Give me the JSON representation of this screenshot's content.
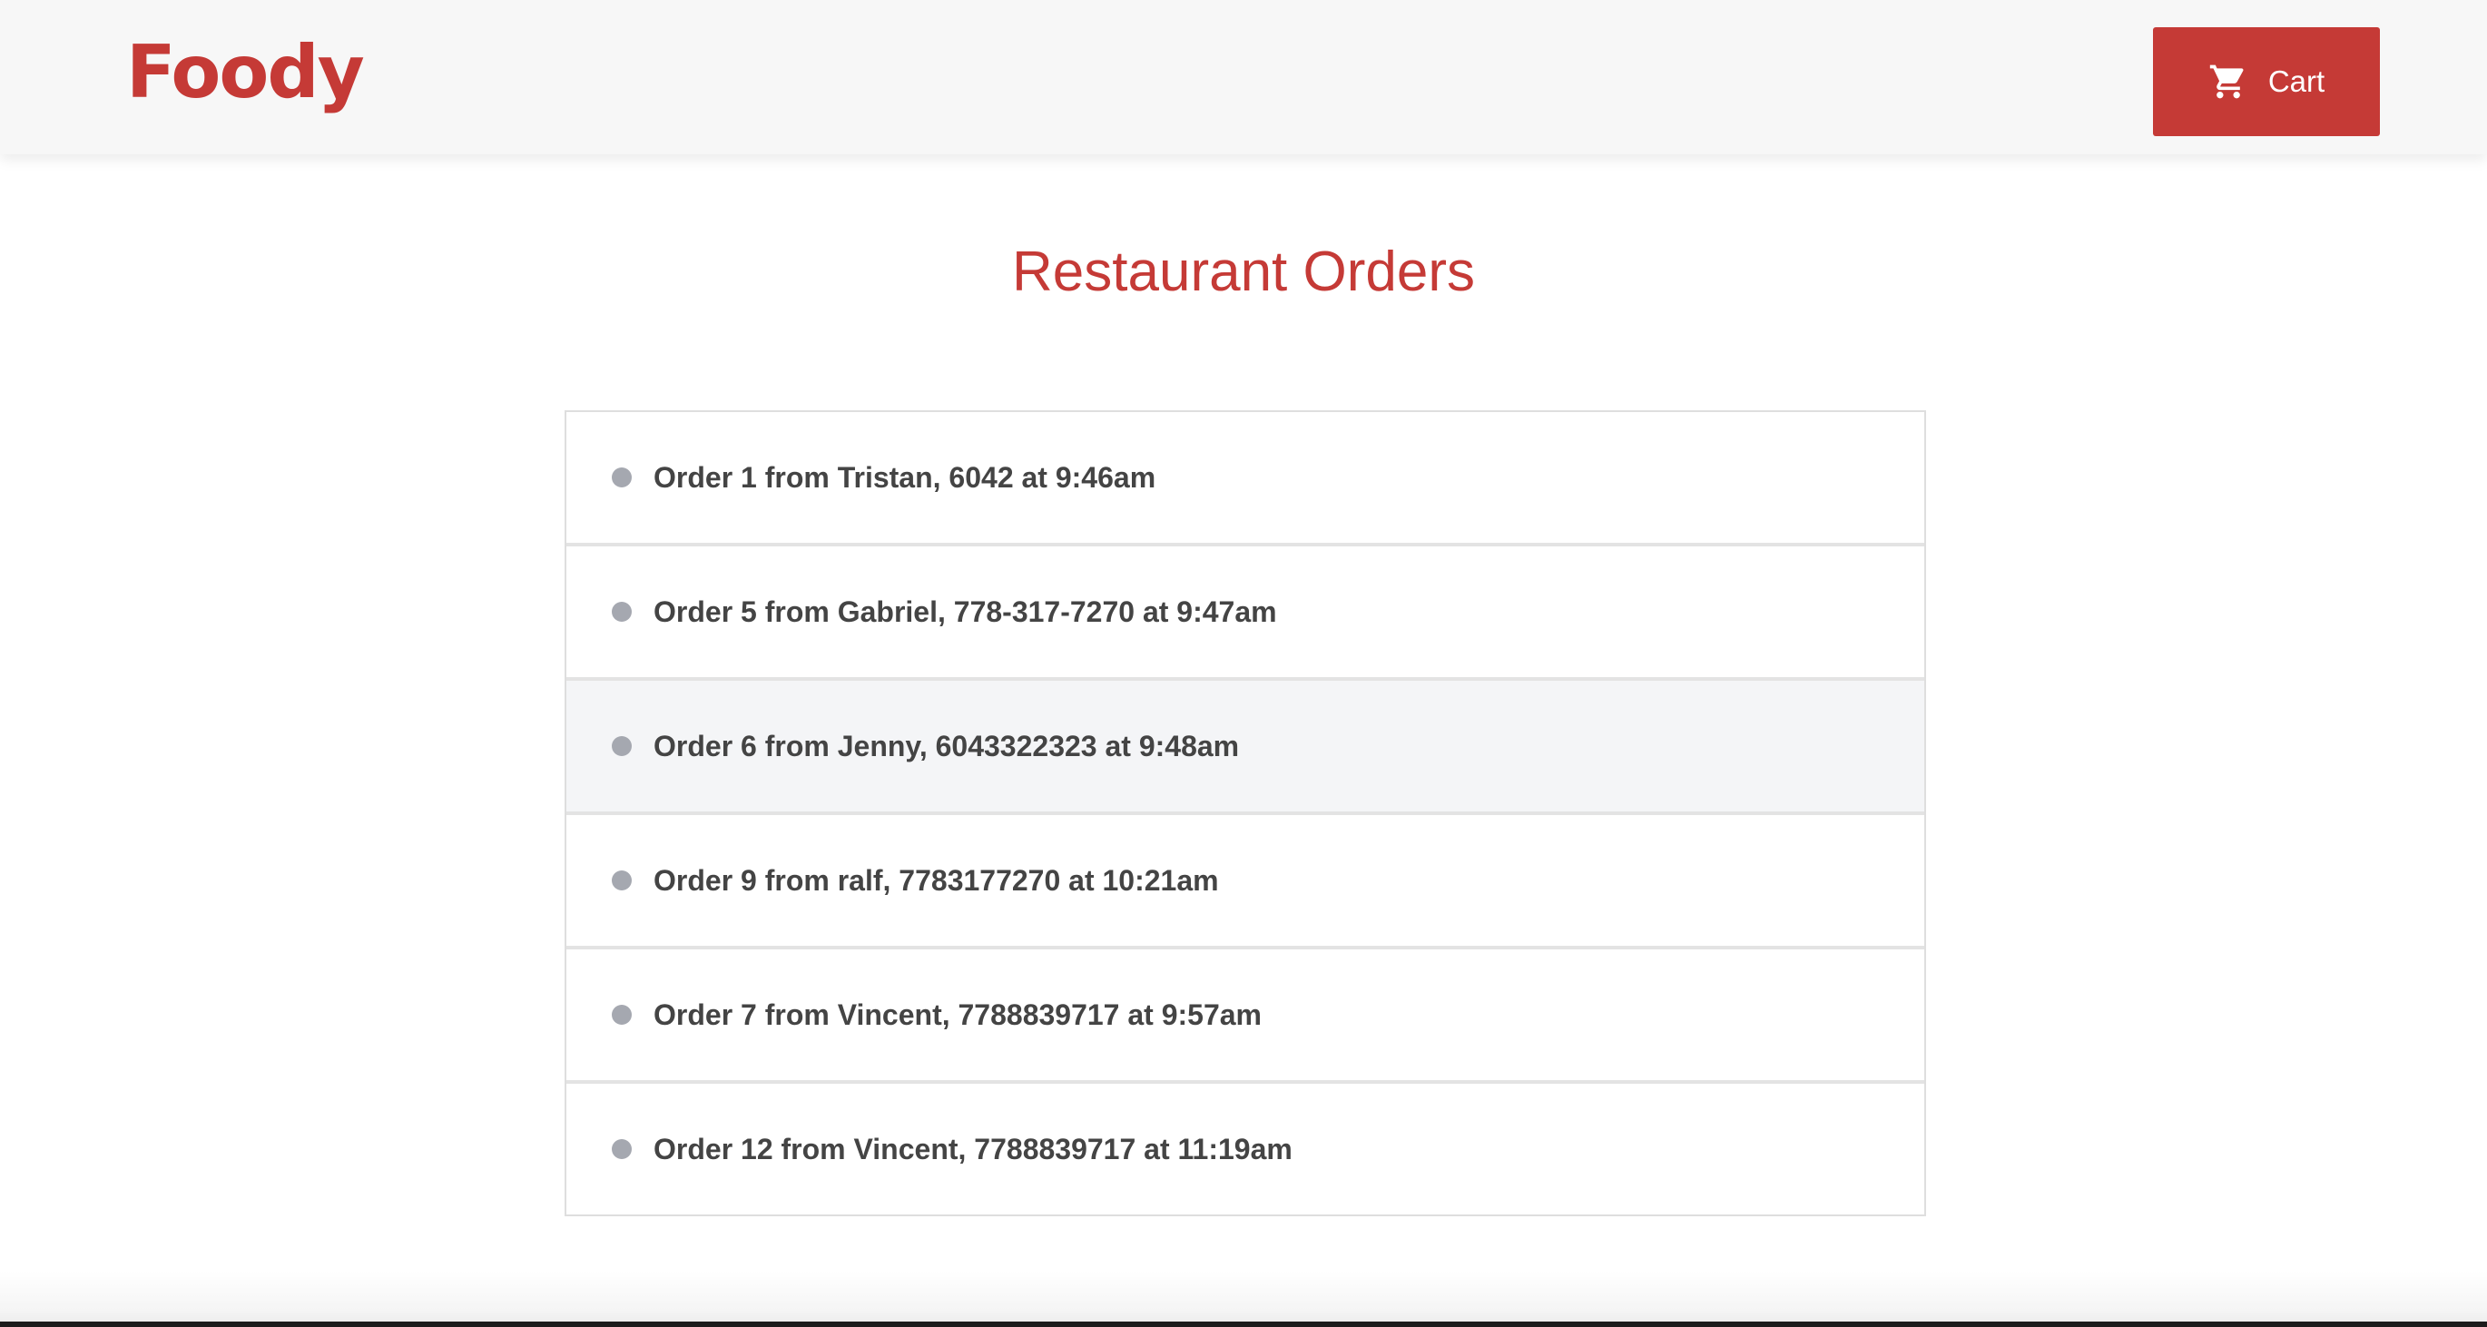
{
  "header": {
    "logo_text": "Foody",
    "cart_label": "Cart",
    "cart_icon": "shopping-cart-icon",
    "brand_color": "#c53a36"
  },
  "main": {
    "title": "Restaurant Orders",
    "orders": [
      {
        "text": "Order 1 from Tristan, 6042 at 9:46am"
      },
      {
        "text": "Order 5 from Gabriel, 778-317-7270 at 9:47am"
      },
      {
        "text": "Order 6 from Jenny, 6043322323 at 9:48am"
      },
      {
        "text": "Order 9 from ralf, 7783177270 at 10:21am"
      },
      {
        "text": "Order 7 from Vincent, 7788839717 at 9:57am"
      },
      {
        "text": "Order 12 from Vincent, 7788839717 at 11:19am"
      }
    ],
    "status_dot_color": "#a5a8b0",
    "highlighted_row_color": "#f4f5f7"
  }
}
